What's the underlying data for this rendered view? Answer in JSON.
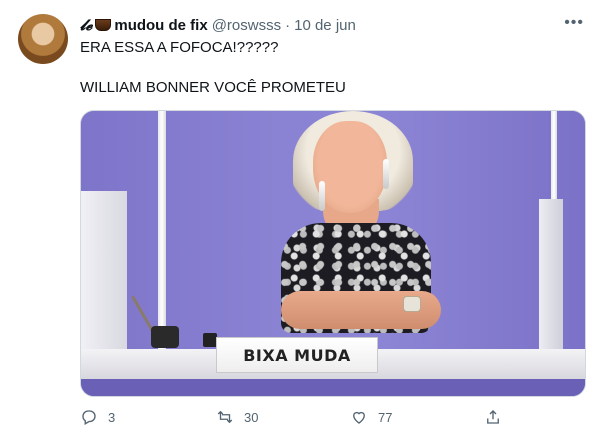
{
  "tweet": {
    "author": {
      "name_prefix": "𝓵𝓮",
      "name": "mudou de fix",
      "handle": "@roswsss",
      "separator": "·",
      "date": "10 de jun"
    },
    "more_icon": "more-horizontal-icon",
    "text_lines": [
      "ERA ESSA A FOFOCA!?????",
      "WILLIAM BONNER VOCÊ PROMETEU"
    ],
    "media": {
      "nameplate_text": "BIXA MUDA"
    },
    "actions": {
      "reply_count": "3",
      "retweet_count": "30",
      "like_count": "77"
    }
  }
}
